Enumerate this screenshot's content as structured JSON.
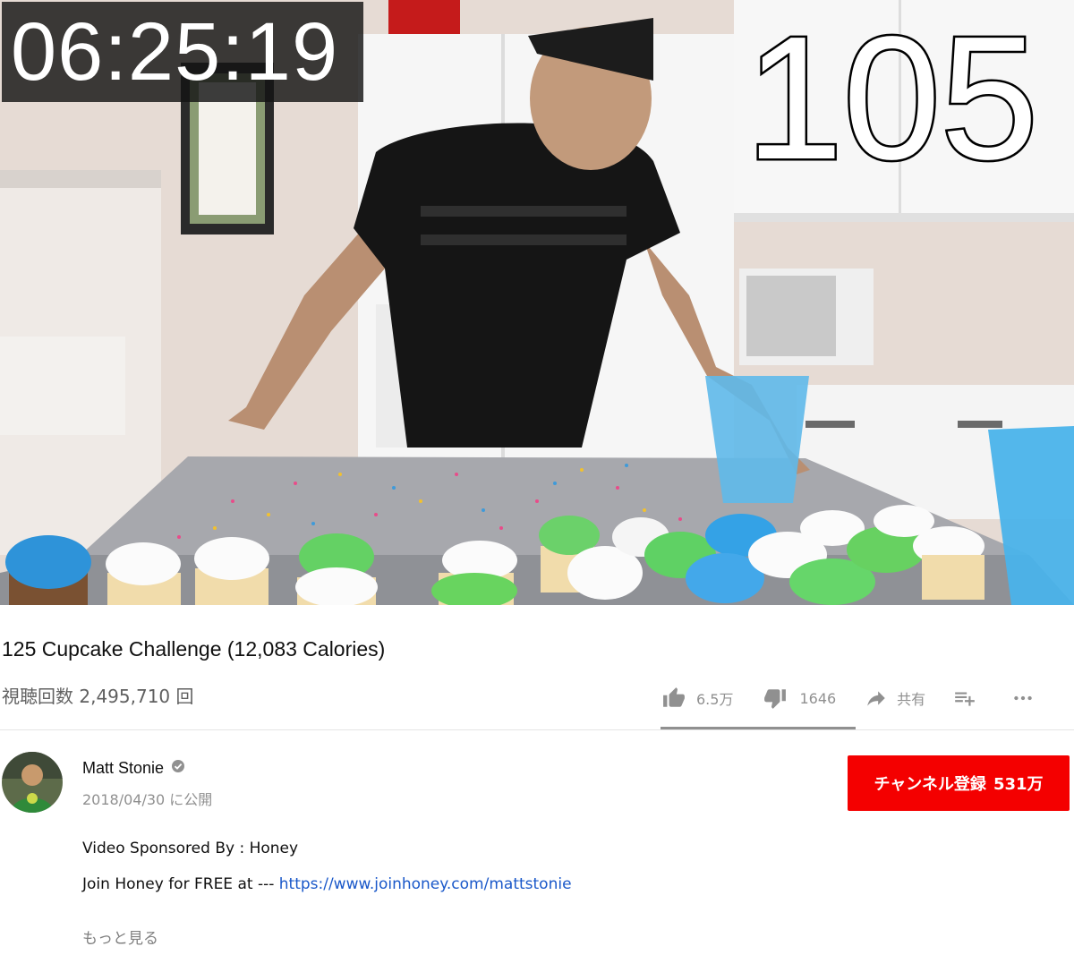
{
  "video": {
    "timer_text": "06:25:19",
    "counter_text": "105"
  },
  "meta": {
    "title": "125 Cupcake Challenge (12,083 Calories)",
    "views": "視聴回数 2,495,710 回"
  },
  "actions": {
    "like_count": "6.5万",
    "dislike_count": "1646",
    "share_label": "共有",
    "save_icon": "playlist-add-icon",
    "more_icon": "more-horiz-icon",
    "like_fraction": 0.975
  },
  "channel": {
    "name": "Matt Stonie",
    "published": "2018/04/30 に公開",
    "subscribe_label": "チャンネル登録",
    "subscriber_count": "531万",
    "subscribe_color": "#f40000"
  },
  "description": {
    "line1": "Video Sponsored By : Honey",
    "line2_prefix": "Join Honey for FREE at ---",
    "line2_link": "https://www.joinhoney.com/mattstonie",
    "more_label": "もっと見る"
  }
}
